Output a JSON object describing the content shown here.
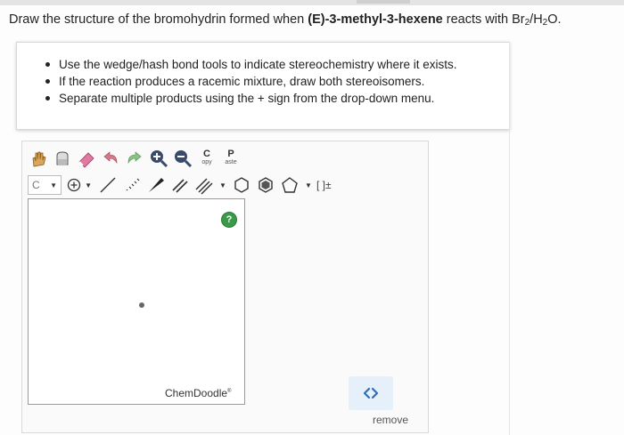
{
  "question": {
    "prefix": "Draw the structure of the bromohydrin formed when ",
    "compound": "(E)-3-methyl-3-hexene",
    "middle": " reacts with Br",
    "sub1": "2",
    "slash": "/H",
    "sub2": "2",
    "suffix": "O."
  },
  "instructions": [
    "Use the wedge/hash bond tools to indicate stereochemistry where it exists.",
    "If the reaction produces a racemic mixture, draw both stereoisomers.",
    "Separate multiple products using the + sign from the drop-down menu."
  ],
  "toolbar": {
    "copy_big": "C",
    "copy_small": "opy",
    "paste_big": "P",
    "paste_small": "aste",
    "element_value": "C",
    "charge_bracket": "[ ]±"
  },
  "editor": {
    "brand": "ChemDoodle",
    "brand_mark": "®",
    "help": "?",
    "remove_label": "remove"
  },
  "colors": {
    "help_green": "#3a9a48",
    "expand_bg": "#e6f0fb",
    "expand_arrow": "#2f6fb5"
  }
}
